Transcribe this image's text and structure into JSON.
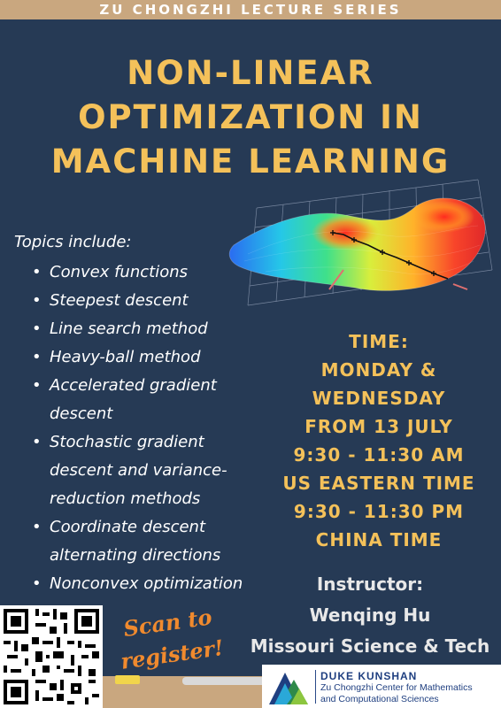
{
  "header": {
    "series": "ZU CHONGZHI LECTURE SERIES"
  },
  "title": {
    "line1": "NON-LINEAR",
    "line2": "OPTIMIZATION IN",
    "line3": "MACHINE LEARNING"
  },
  "topics": {
    "heading": "Topics include:",
    "items": [
      {
        "lines": [
          "Convex functions"
        ]
      },
      {
        "lines": [
          "Steepest descent"
        ]
      },
      {
        "lines": [
          "Line search method"
        ]
      },
      {
        "lines": [
          "Heavy-ball method"
        ]
      },
      {
        "lines": [
          "Accelerated gradient",
          "descent"
        ]
      },
      {
        "lines": [
          "Stochastic gradient",
          "descent and variance-",
          "reduction methods"
        ]
      },
      {
        "lines": [
          "Coordinate descent",
          "alternating directions"
        ]
      },
      {
        "lines": [
          "Nonconvex optimization"
        ]
      }
    ]
  },
  "schedule": {
    "lines": [
      "TIME:",
      "MONDAY &",
      "WEDNESDAY",
      "FROM 13 JULY",
      "9:30 - 11:30 AM",
      "US EASTERN TIME",
      "9:30 - 11:30 PM",
      "CHINA TIME"
    ]
  },
  "instructor": {
    "label": "Instructor:",
    "name": "Wenqing Hu",
    "affiliation": "Missouri Science & Tech"
  },
  "registration": {
    "line1": "Scan to",
    "line2": "register!"
  },
  "logo": {
    "line1": "DUKE KUNSHAN",
    "line2": "Zu Chongzhi Center for Mathematics",
    "line3": "and Computational Sciences"
  },
  "colors": {
    "background": "#263a55",
    "accent_yellow": "#f4c15a",
    "band_tan": "#c9a77f",
    "scan_orange": "#f08a2e",
    "logo_blue": "#1f3f80"
  },
  "icons": {
    "surface": "optimization-surface-plot",
    "qr": "qr-code",
    "logo": "duke-kunshan-logo"
  }
}
